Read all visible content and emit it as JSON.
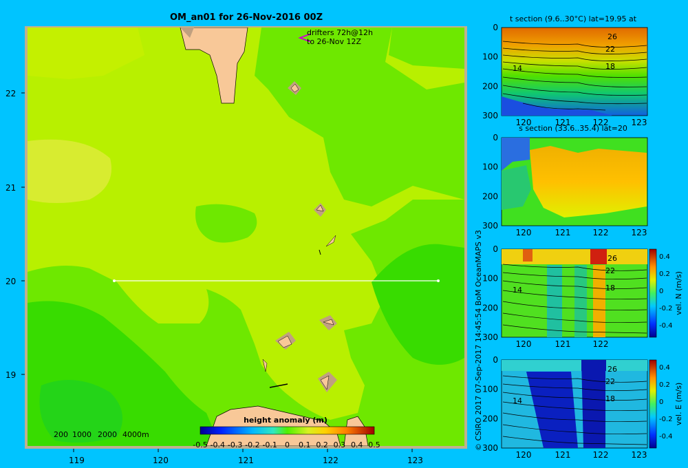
{
  "main_map": {
    "title": "OM_an01 for 26-Nov-2016 00Z",
    "lon_ticks": [
      "119",
      "120",
      "121",
      "122",
      "123"
    ],
    "lat_ticks": [
      "22",
      "21",
      "20",
      "19"
    ],
    "drifters_line1": "drifters 72h@12h",
    "drifters_line2": "to 26-Nov 12Z",
    "depth_legend": [
      "200",
      "1000",
      "2000",
      "4000m"
    ],
    "colorbar_title": "height anomaly (m)",
    "colorbar_ticks": [
      "-0.5",
      "-0.4",
      "-0.3",
      "-0.2",
      "-0.1",
      "0",
      "0.1",
      "0.2",
      "0.3",
      "0.4",
      "0.5"
    ]
  },
  "sections": [
    {
      "id": "temp",
      "title": "t section (9.6..30°C) lat=19.95 at",
      "x_ticks": [
        "120",
        "121",
        "122",
        "123"
      ],
      "y_ticks": [
        "0",
        "100",
        "200",
        "300"
      ],
      "contour_labels": [
        "26",
        "22",
        "18",
        "14"
      ],
      "colorbar": null
    },
    {
      "id": "salt",
      "title": "s section (33.6..35.4) lat=20",
      "x_ticks": [
        "120",
        "121",
        "122",
        "123"
      ],
      "y_ticks": [
        "0",
        "100",
        "200",
        "300"
      ],
      "contour_labels": [],
      "colorbar": null
    },
    {
      "id": "veln",
      "title": "",
      "x_ticks": [
        "120",
        "121",
        "122"
      ],
      "y_ticks": [
        "0",
        "100",
        "200",
        "300"
      ],
      "contour_labels": [
        "26",
        "22",
        "18",
        "14"
      ],
      "colorbar": {
        "label": "vel. N (m/s)",
        "ticks": [
          "0.4",
          "0.2",
          "0",
          "-0.2",
          "-0.4"
        ]
      }
    },
    {
      "id": "vele",
      "title": "",
      "x_ticks": [
        "120",
        "121",
        "122",
        "123"
      ],
      "y_ticks": [
        "0",
        "100",
        "200",
        "300"
      ],
      "contour_labels": [
        "26",
        "22",
        "18",
        "14"
      ],
      "colorbar": {
        "label": "vel. E (m/s)",
        "ticks": [
          "0.4",
          "0.2",
          "0",
          "-0.2",
          "-0.4"
        ]
      }
    }
  ],
  "credit": "© CSIRO 2017   07-Sep-2017 14:45:54 BoM OceanMAPS v3",
  "chart_data": [
    {
      "type": "heatmap",
      "title": "OM_an01 for 26-Nov-2016 00Z",
      "xlabel": "",
      "ylabel": "",
      "xlim": [
        118.5,
        123.5
      ],
      "ylim": [
        18.25,
        22.7
      ],
      "colorbar_label": "height anomaly (m)",
      "clim": [
        -0.5,
        0.5
      ],
      "section_line": {
        "lat": 20,
        "lon_start": 119.5,
        "lon_end": 123.2
      }
    },
    {
      "type": "heatmap",
      "title": "t section (9.6..30°C) lat=19.95 at",
      "x_range": [
        119.5,
        123.2
      ],
      "y_range": [
        0,
        300
      ],
      "clim": [
        9.6,
        30
      ],
      "contour_levels": [
        14,
        18,
        22,
        26
      ]
    },
    {
      "type": "heatmap",
      "title": "s section (33.6..35.4) lat=20",
      "x_range": [
        119.5,
        123.2
      ],
      "y_range": [
        0,
        300
      ],
      "clim": [
        33.6,
        35.4
      ]
    },
    {
      "type": "heatmap",
      "title": "",
      "colorbar_label": "vel. N (m/s)",
      "x_range": [
        119.5,
        123.2
      ],
      "y_range": [
        0,
        300
      ],
      "clim": [
        -0.4,
        0.4
      ]
    },
    {
      "type": "heatmap",
      "title": "",
      "colorbar_label": "vel. E (m/s)",
      "x_range": [
        119.5,
        123.2
      ],
      "y_range": [
        0,
        300
      ],
      "clim": [
        -0.4,
        0.4
      ]
    }
  ]
}
